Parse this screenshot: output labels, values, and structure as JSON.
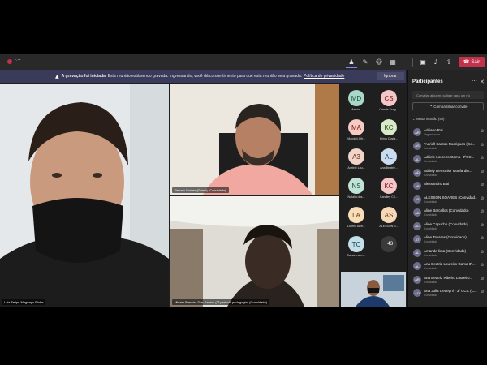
{
  "topbar": {
    "timer": "-:--",
    "icons": [
      "people-icon",
      "chat-icon",
      "reactions-icon",
      "view-icon",
      "more-icon"
    ],
    "leave_label": "Sair"
  },
  "banner": {
    "prefix": "A gravação foi iniciada.",
    "text": "Esta reunião está sendo gravada. Ingressando, você dá consentimento para que esta reunião seja gravada.",
    "privacy": "Política de privacidade",
    "ignore": "Ignorar"
  },
  "tiles": {
    "luiz": "Luiz Felipe Magnago Blube",
    "renato": "Renato Soiaes (Guest) (Convidado)",
    "miriam": "Miriam Barreira Dos Santos (2º período pedagogia) (Convidado)"
  },
  "gallery": [
    {
      "initials": "MD",
      "name": "Marcia...",
      "bg": "#a8d8c8",
      "fg": "#1a4a3a"
    },
    {
      "initials": "CS",
      "name": "Camila Scag...",
      "bg": "#f4c6c6",
      "fg": "#6a1a1a"
    },
    {
      "initials": "MA",
      "name": "Mandeli Alfr...",
      "bg": "#f9c9c3",
      "fg": "#6a1a10"
    },
    {
      "initials": "KC",
      "name": "Kilma Costa...",
      "bg": "#d8e9c8",
      "fg": "#2a4a1a"
    },
    {
      "initials": "A3",
      "name": "Adriele Lou...",
      "bg": "#f3d4c8",
      "fg": "#5a2a1a"
    },
    {
      "initials": "AL",
      "name": "Ana Beatriz...",
      "bg": "#c9dcf0",
      "fg": "#1a3a5a"
    },
    {
      "initials": "NS",
      "name": "Natalia dos...",
      "bg": "#bfe3d6",
      "fg": "#1a4a3a"
    },
    {
      "initials": "KC",
      "name": "Kandley Cri...",
      "bg": "#f4c6c6",
      "fg": "#6a1a1a"
    },
    {
      "initials": "LA",
      "name": "Lorena Alve...",
      "bg": "#f9dcb8",
      "fg": "#5a3a10"
    },
    {
      "initials": "AS",
      "name": "ALESSON S...",
      "bg": "#f6d8b8",
      "fg": "#5a3a10"
    },
    {
      "initials": "TC",
      "name": "Tamara sem...",
      "bg": "#c3e0e8",
      "fg": "#1a3a4a"
    }
  ],
  "gallery_more": "+43",
  "panel": {
    "title": "Participantes",
    "invite_placeholder": "Convidar alguém ou ligar para um nú",
    "share_label": "Compartilhar convite",
    "section_label": "Nesta reunião (59)",
    "participants": [
      {
        "initials": "AR",
        "name": "Adriano Rai",
        "role": "Organizador"
      },
      {
        "initials": "AS",
        "name": "\"Adriell Santos Rodrigues (Co...",
        "role": "Convidado"
      },
      {
        "initials": "AL",
        "name": "Adriele Loureiro Gama- 3ºCC...",
        "role": "Convidado"
      },
      {
        "initials": "AD",
        "name": "Adriely Demonier Monfardin...",
        "role": "Convidado"
      },
      {
        "initials": "AB",
        "name": "Alessandro Bitti",
        "role": ""
      },
      {
        "initials": "AS",
        "name": "ALESSON SOARES (Convidad...",
        "role": "Convidado"
      },
      {
        "initials": "AB",
        "name": "Aline Barcellos (Convidado)",
        "role": "Convidado"
      },
      {
        "initials": "AC",
        "name": "Aline Capucho (Convidado)",
        "role": "Convidado"
      },
      {
        "initials": "AT",
        "name": "Aline Tavares (Convidado)",
        "role": "Convidado"
      },
      {
        "initials": "AL",
        "name": "Amanda lima (Convidado)",
        "role": "Convidado"
      },
      {
        "initials": "AL",
        "name": "Ana Beatriz Loureiro Gama 3º...",
        "role": "Convidado"
      },
      {
        "initials": "AR",
        "name": "Ana Beatriz Ribeiro Loureiro...",
        "role": "Convidado"
      },
      {
        "initials": "AO",
        "name": "Ana Julia Oettegni - 3º CCC (C...",
        "role": "Convidado"
      }
    ]
  }
}
